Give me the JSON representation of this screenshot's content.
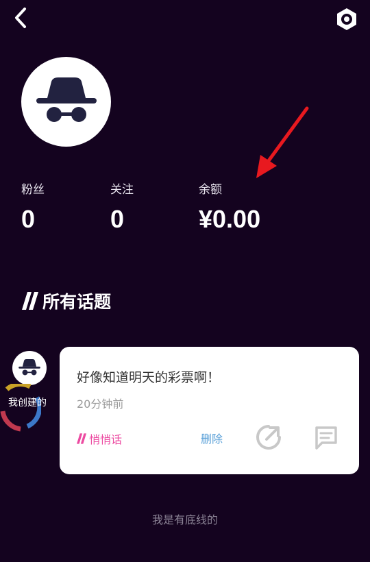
{
  "header": {
    "back_icon": "chevron-left-icon",
    "settings_icon": "gear-icon"
  },
  "profile": {
    "avatar_icon": "incognito-hat-glasses-icon",
    "stats": [
      {
        "label": "粉丝",
        "value": "0"
      },
      {
        "label": "关注",
        "value": "0"
      },
      {
        "label": "余额",
        "value": "¥0.00"
      }
    ]
  },
  "annotation": {
    "arrow_color": "#e8191f"
  },
  "topics": {
    "section_title": "所有话题",
    "section_icon": "double-slash-icon",
    "creator_label": "我创建的",
    "items": [
      {
        "title": "好像知道明天的彩票啊！",
        "time": "20分钟前",
        "whisper_label": "悄悄话",
        "delete_label": "删除",
        "share_icon": "share-arrow-icon",
        "comment_icon": "comment-icon"
      }
    ]
  },
  "footer": {
    "text": "我是有底线的"
  },
  "colors": {
    "background": "#14031f",
    "card": "#ffffff",
    "whisper_accent": "#ec4aa1",
    "delete_accent": "#5aa0d8"
  }
}
